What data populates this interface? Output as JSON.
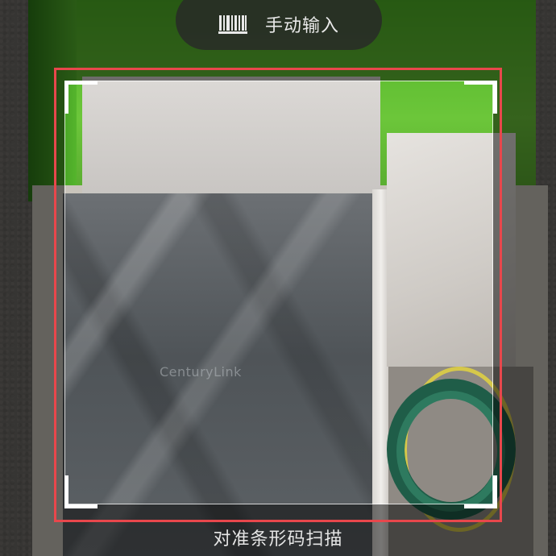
{
  "top_bar": {
    "manual_input_label": "手动输入",
    "manual_input_icon": "barcode-icon"
  },
  "scanner": {
    "hint": "对准条形码扫描",
    "frame_color": "#ffffff",
    "highlight_color": "#e8474c"
  },
  "camera_preview": {
    "package_logo_text": "CenturyLink"
  }
}
